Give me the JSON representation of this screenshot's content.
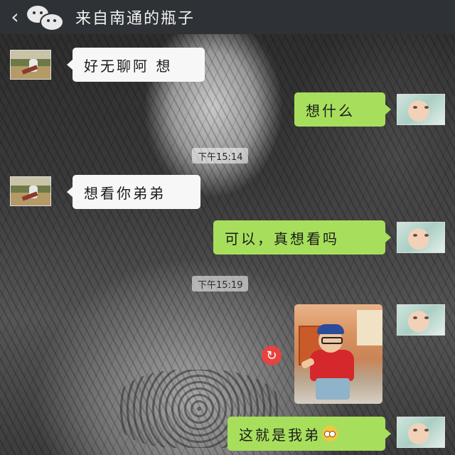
{
  "header": {
    "back_glyph": "‹",
    "title": "来自南通的瓶子",
    "logo_icon": "wechat-icon"
  },
  "messages": [
    {
      "id": 1,
      "side": "left",
      "text": "好无聊阿 想"
    },
    {
      "id": 2,
      "side": "right",
      "text": "想什么"
    },
    {
      "id": 3,
      "side": "left",
      "text": "想看你弟弟"
    },
    {
      "id": 4,
      "side": "right",
      "text": "可以，真想看吗"
    },
    {
      "id": 5,
      "side": "right",
      "type": "image",
      "description_icon": "photo-thumbnail",
      "retry_icon": "resend-icon"
    },
    {
      "id": 6,
      "side": "right",
      "text": "这就是我弟",
      "emoji_icon": "surprised-emoji-icon"
    }
  ],
  "timestamps": [
    "下午15:14",
    "下午15:19"
  ],
  "colors": {
    "titlebar": "#2e3236",
    "bubble_green": "#a7df5d",
    "bubble_white": "#f7f7f7",
    "retry_red": "#e64340"
  }
}
